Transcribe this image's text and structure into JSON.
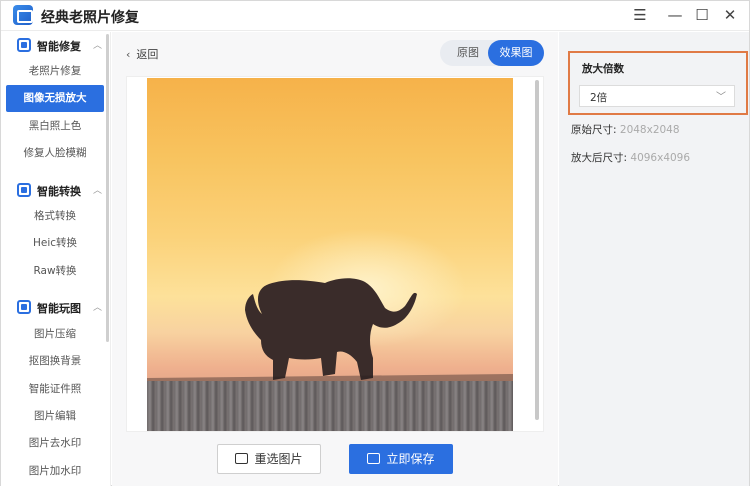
{
  "app": {
    "title": "经典老照片修复"
  },
  "window": {
    "menu_icon": "☰",
    "min_icon": "—",
    "max_icon": "☐",
    "close_icon": "✕"
  },
  "sidebar": {
    "groups": [
      {
        "label": "智能修复",
        "icon": "image-icon",
        "items": [
          "老照片修复",
          "图像无损放大",
          "黑白照上色",
          "修复人脸模糊"
        ]
      },
      {
        "label": "智能转换",
        "icon": "convert-icon",
        "items": [
          "格式转换",
          "Heic转换",
          "Raw转换"
        ]
      },
      {
        "label": "智能玩图",
        "icon": "image-icon",
        "items": [
          "图片压缩",
          "抠图换背景",
          "智能证件照",
          "图片编辑",
          "图片去水印",
          "图片加水印"
        ]
      }
    ],
    "active_item": "图像无损放大"
  },
  "main": {
    "back_label": "返回",
    "toggle": {
      "original": "原图",
      "effect": "效果图",
      "selected": "效果图"
    },
    "reselect_label": "重选图片",
    "save_label": "立即保存"
  },
  "settings": {
    "zoom_label": "放大倍数",
    "zoom_value": "2倍",
    "original_size_label": "原始尺寸:",
    "original_size_value": "2048x2048",
    "scaled_size_label": "放大后尺寸:",
    "scaled_size_value": "4096x4096"
  },
  "colors": {
    "accent": "#2b6fe0",
    "highlight_border": "#e07a45"
  }
}
